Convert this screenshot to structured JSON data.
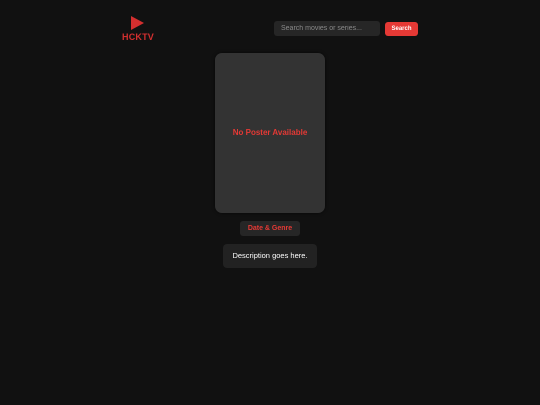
{
  "header": {
    "logo_text": "HCKTV",
    "logo_icon": "play-icon",
    "search": {
      "placeholder": "Search movies or series...",
      "value": "",
      "button_label": "Search"
    }
  },
  "main": {
    "poster_placeholder": "No Poster Available",
    "date_genre": "Date & Genre",
    "description": "Description goes here."
  },
  "colors": {
    "background": "#111111",
    "accent": "#e53935",
    "card": "#333333"
  }
}
